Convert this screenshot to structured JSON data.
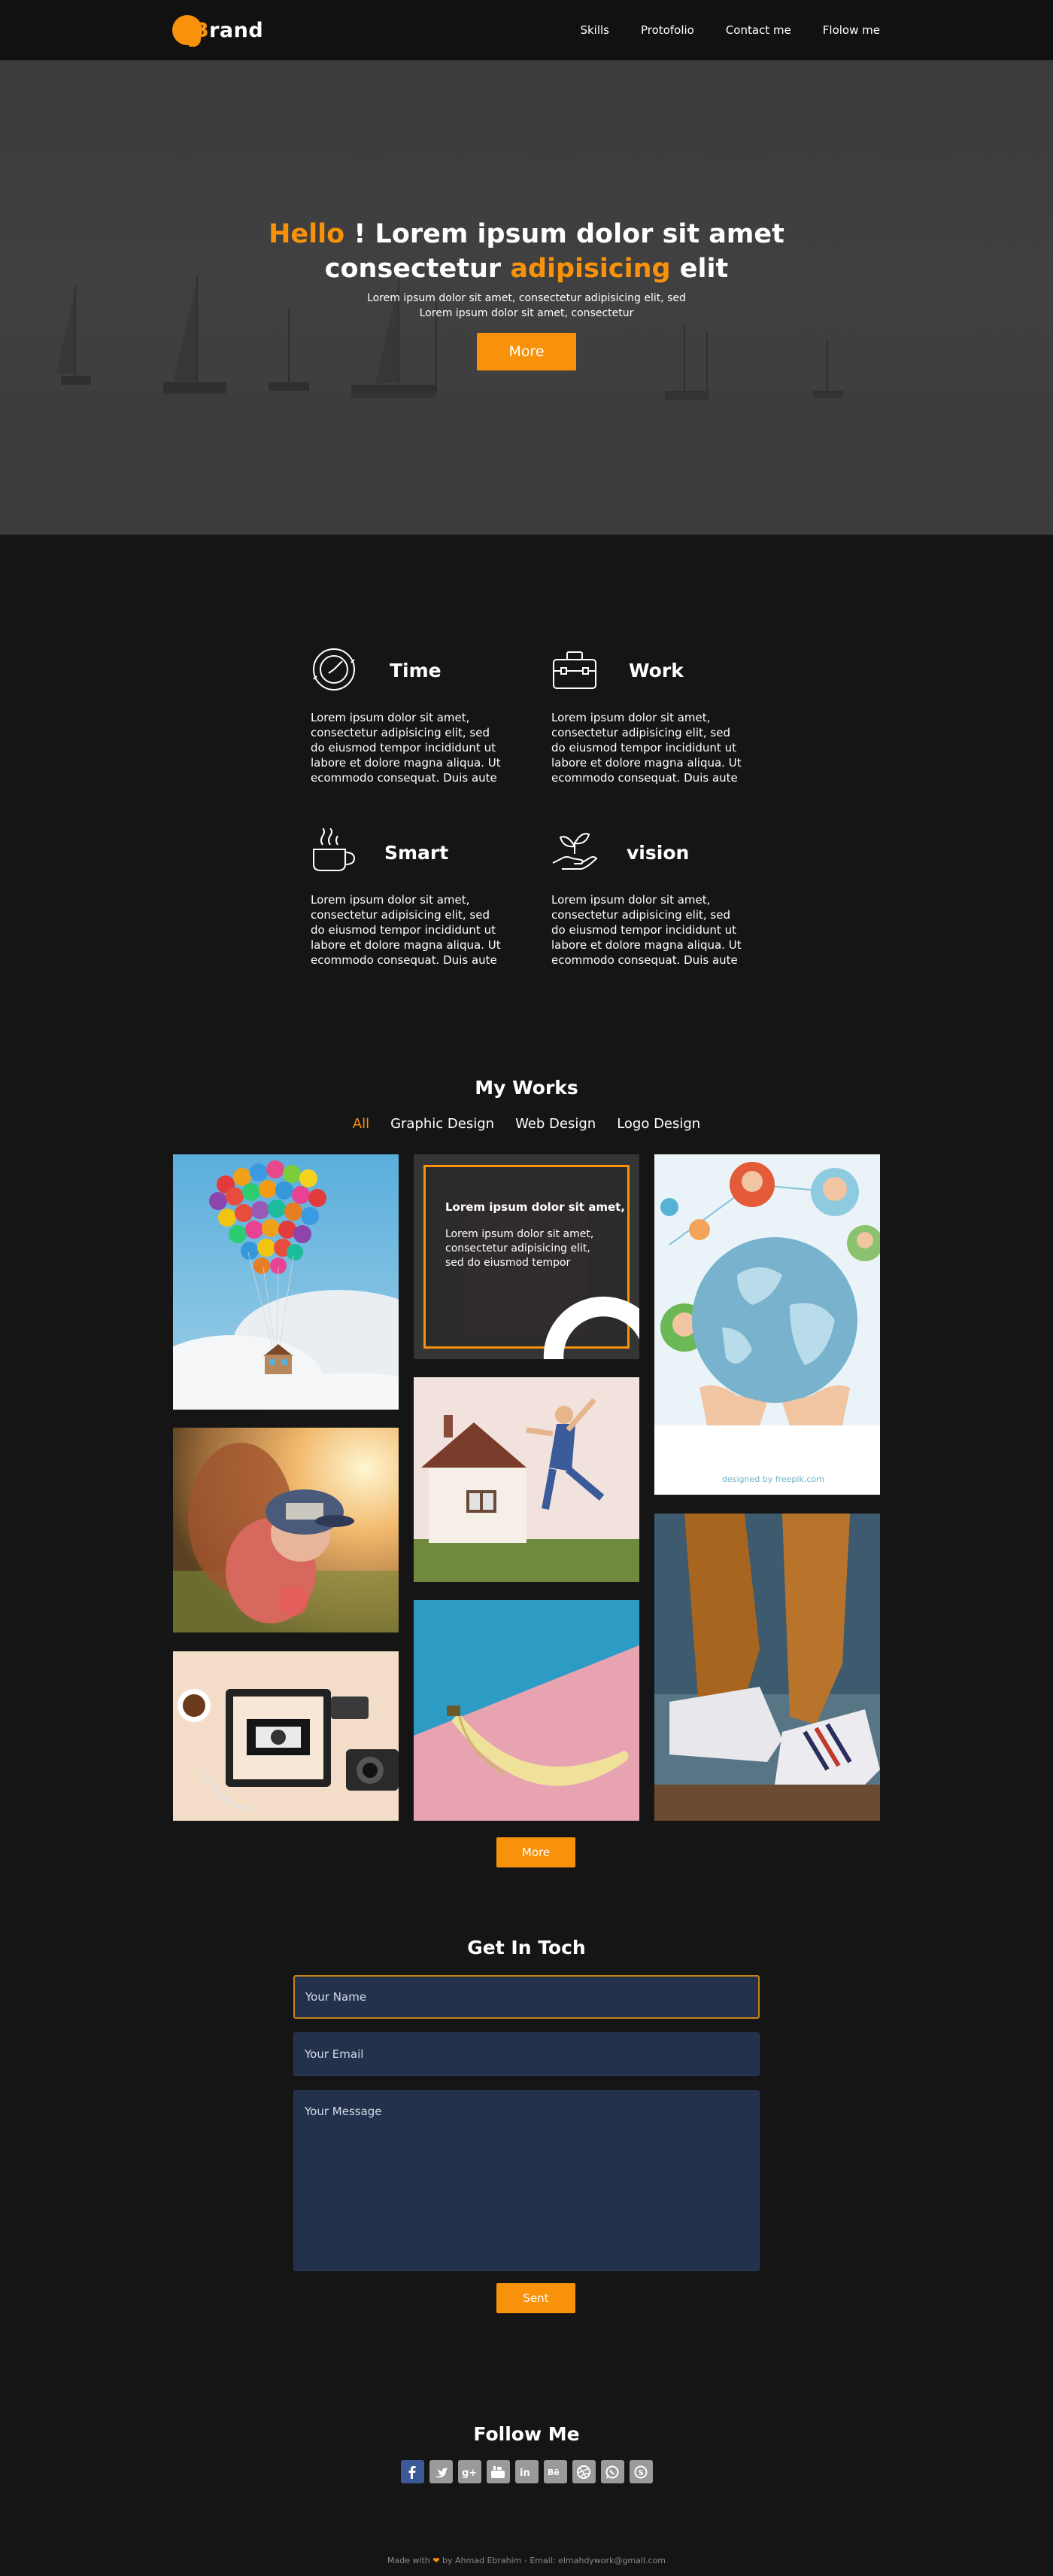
{
  "nav": {
    "brand_first_letter": "B",
    "brand_rest": "rand",
    "links": [
      "Skills",
      "Protofolio",
      "Contact me",
      "Flolow me"
    ]
  },
  "hero": {
    "title_hello": "Hello",
    "title_part1": " ! Lorem ipsum dolor sit amet",
    "title_part2": "consectetur ",
    "title_accent": "adipisicing",
    "title_part3": " elit",
    "subtitle_line1": "Lorem ipsum dolor sit amet, consectetur adipisicing elit, sed",
    "subtitle_line2": "Lorem ipsum dolor sit amet, consectetur",
    "button": "More"
  },
  "services": [
    {
      "title": "Time",
      "icon": "compass-clock-icon",
      "text": "Lorem ipsum dolor sit amet, consectetur adipisicing elit, sed do eiusmod tempor incididunt ut labore et dolore magna aliqua. Ut ecommodo consequat. Duis aute"
    },
    {
      "title": "Work",
      "icon": "briefcase-icon",
      "text": "Lorem ipsum dolor sit amet, consectetur adipisicing elit, sed do eiusmod tempor incididunt ut labore et dolore magna aliqua. Ut ecommodo consequat. Duis aute"
    },
    {
      "title": "Smart",
      "icon": "coffee-cup-icon",
      "text": "Lorem ipsum dolor sit amet, consectetur adipisicing elit, sed do eiusmod tempor incididunt ut labore et dolore magna aliqua. Ut ecommodo consequat. Duis aute"
    },
    {
      "title": "vision",
      "icon": "hand-plant-icon",
      "text": "Lorem ipsum dolor sit amet, consectetur adipisicing elit, sed do eiusmod tempor incididunt ut labore et dolore magna aliqua. Ut ecommodo consequat. Duis aute"
    }
  ],
  "works": {
    "title": "My Works",
    "filters": [
      "All",
      "Graphic Design",
      "Web Design",
      "Logo Design"
    ],
    "active_filter": "All",
    "overlay_title": "Lorem ipsum dolor sit amet,",
    "overlay_text": "Lorem ipsum dolor sit amet, consectetur adipisicing elit, sed do eiusmod tempor",
    "more_button": "More",
    "watermark": "designed by freepik.com"
  },
  "contact": {
    "title": "Get In Toch",
    "name_placeholder": "Your Name",
    "email_placeholder": "Your Email",
    "message_placeholder": "Your Message",
    "send_button": "Sent"
  },
  "follow": {
    "title": "Follow Me",
    "icons": [
      "facebook-icon",
      "twitter-icon",
      "google-plus-icon",
      "youtube-icon",
      "linkedin-icon",
      "behance-icon",
      "dribbble-icon",
      "whatsapp-icon",
      "skype-icon"
    ]
  },
  "footer": {
    "made_with": "Made with ",
    "heart": "❤",
    "rest": " by Ahmad Ebrahim - Email: elmahdywork@gmail.com"
  },
  "colors": {
    "accent": "#f7920a",
    "background": "#151515",
    "navbar": "#111111",
    "field": "#24314d"
  }
}
